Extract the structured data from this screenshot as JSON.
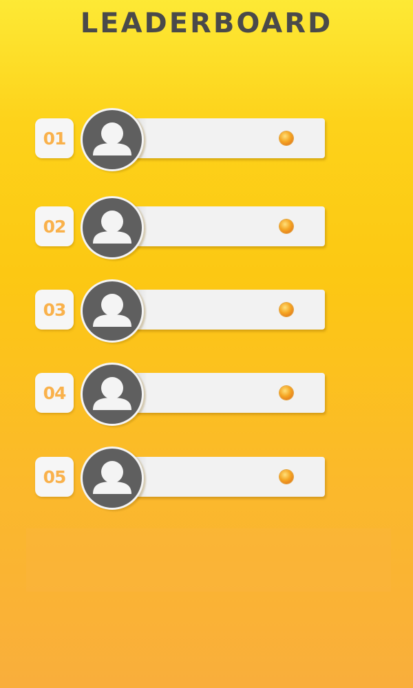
{
  "header": {
    "title": "LEADERBOARD"
  },
  "leaderboard": {
    "entries": [
      {
        "rank": "01",
        "avatar_icon": "user-avatar-icon",
        "coin_icon": "coin-icon"
      },
      {
        "rank": "02",
        "avatar_icon": "user-avatar-icon",
        "coin_icon": "coin-icon"
      },
      {
        "rank": "03",
        "avatar_icon": "user-avatar-icon",
        "coin_icon": "coin-icon"
      },
      {
        "rank": "04",
        "avatar_icon": "user-avatar-icon",
        "coin_icon": "coin-icon"
      },
      {
        "rank": "05",
        "avatar_icon": "user-avatar-icon",
        "coin_icon": "coin-icon"
      }
    ]
  },
  "colors": {
    "background_top": "#fde935",
    "background_bottom": "#f9ae3c",
    "title": "#4a4a4a",
    "rank_text": "#f9b14b",
    "panel": "#f2f2f2",
    "avatar": "#5f5f5f",
    "coin": "#f5a623"
  }
}
